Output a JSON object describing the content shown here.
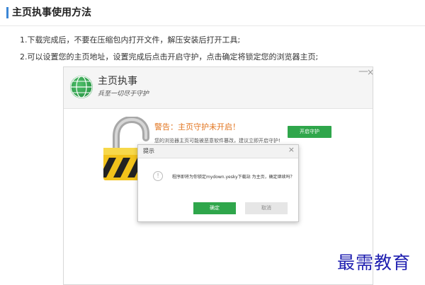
{
  "section": {
    "title": "主页执事使用方法"
  },
  "steps": [
    "1.下载完成后，不要在压缩包内打开文件，解压安装后打开工具;",
    "2.可以设置您的主页地址，设置完成后点击开启守护，点击确定将锁定您的浏览器主页;"
  ],
  "app_window": {
    "app_name": "主页执事",
    "slogan": "兵至一切尽于守护",
    "minimize_label": "—",
    "close_label": "×",
    "warning_title": "警告：主页守护未开启！",
    "warning_desc": "您的浏览器主页可能被恶意软件篡改，建议立即开启守护!",
    "enable_button": "开启守护"
  },
  "dialog": {
    "title": "提示",
    "close_label": "×",
    "icon_glyph": "!",
    "message": "程序即将为你锁定mydown.yesky下载站 为主页，确定继续吗？",
    "ok_label": "确定",
    "cancel_label": "取消"
  },
  "watermark": "最需教育",
  "colors": {
    "accent_blue": "#3b86d6",
    "primary_green": "#2fa64b",
    "warning_orange": "#e2741e",
    "watermark_blue": "#1f1fb0"
  }
}
